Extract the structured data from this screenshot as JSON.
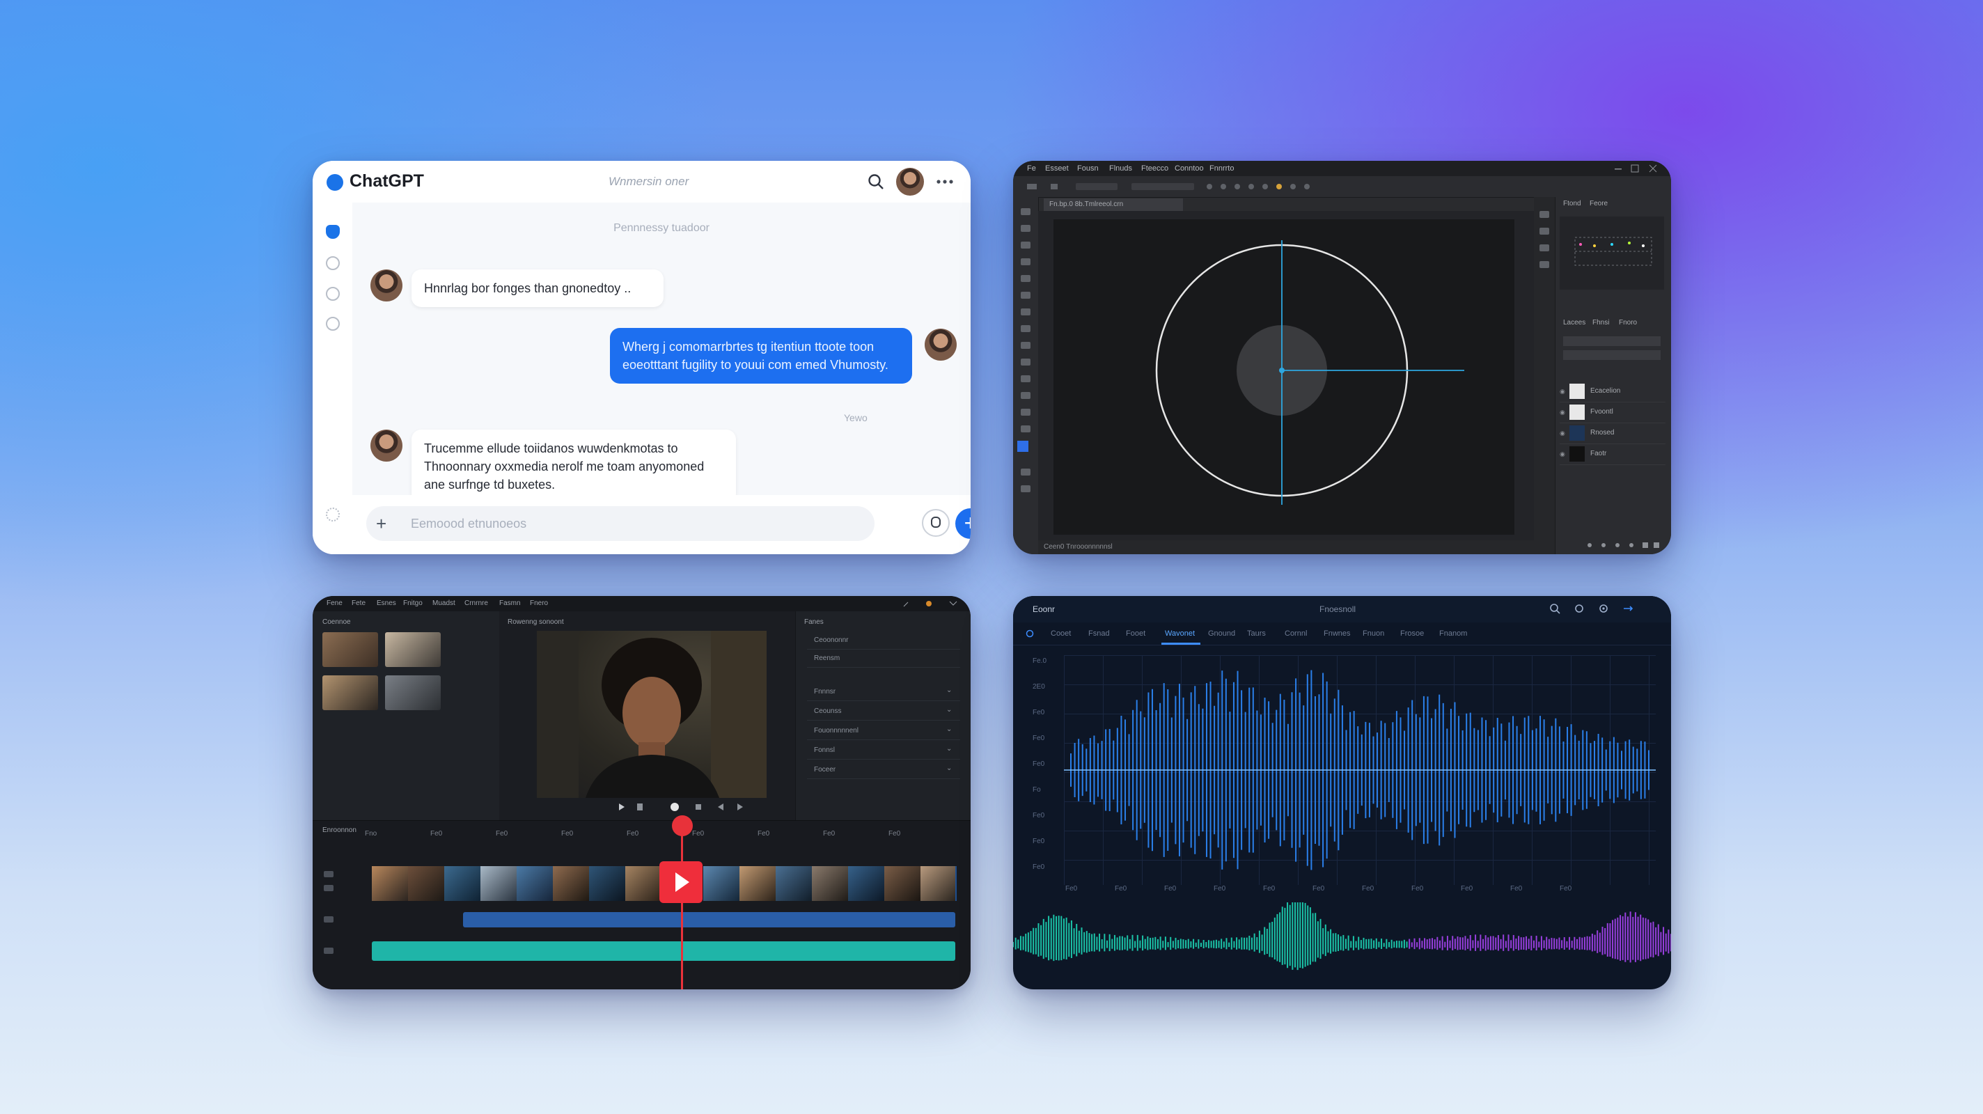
{
  "chat": {
    "app_title": "ChatGPT",
    "subtitle": "Wnmersin oner",
    "date_separator": "Pennnessy tuadoor",
    "messages": [
      {
        "text": "Hnnrlag bor fonges than gnonedtoy .."
      },
      {
        "text": "Wherg j comomarrbrtes tg itentiun ttoote toon eoeotttant fugility to youui com emed Vhumosty."
      },
      {
        "text": "Trucemme ellude toiidanos wuwdenkmotas to Thnoonnary oxxmedia nerolf me toam anyomoned ane surfnge td buxetes."
      }
    ],
    "sent_time": "Yewo",
    "composer_placeholder": "Eemoood etnunoeos",
    "icons": [
      "search-icon",
      "avatar",
      "more-icon",
      "plus-icon",
      "mic-icon",
      "send-icon",
      "settings-icon"
    ]
  },
  "photoshop": {
    "menu": [
      "Fe",
      "Esseet",
      "Fousn",
      "Flnuds",
      "Fteecco",
      "Conntoo",
      "Fnnrrto"
    ],
    "doc_tab": "Fn.bp.0 8b.Tmlreeol.crn",
    "status_text": "Ceen0   Tnrooonnnnnsl",
    "panel_tabs": [
      "Ftond",
      "Feore"
    ],
    "layers_tabs": [
      "Lacees",
      "Fhnsi",
      "Fnoro"
    ],
    "layers": [
      {
        "name": "Ecacelion"
      },
      {
        "name": "Fvoontl"
      },
      {
        "name": "Rnosed"
      },
      {
        "name": "Faotr"
      }
    ],
    "swatch_colors": [
      "#ff5bb8",
      "#2dd9ff",
      "#b7ff3a",
      "#ffd23d",
      "#ff3db0",
      "#6f7480"
    ]
  },
  "video_editor": {
    "menu": [
      "Fene",
      "Fete",
      "Esnes",
      "Fnitgo",
      "Muadst",
      "Crnrnre",
      "Fasmn",
      "Fnero"
    ],
    "media_label": "Coennoe",
    "preview_label": "Rowenng sonoont",
    "props_header": "Fanes",
    "props_items": [
      "Ceoononnr",
      "Reensm",
      "Fnnnsr",
      "Ceounss",
      "Fouonnnnnenl",
      "Fonnsl",
      "Foceer"
    ],
    "timeline_label": "Enroonnon",
    "ruler": [
      "Fno",
      "Fe0",
      "Fe0",
      "Fe0",
      "Fe0",
      "Fe0",
      "Fe0",
      "Fe0",
      "Fe0",
      "Fe0"
    ],
    "icons": [
      "play-icon",
      "playhead-handle"
    ]
  },
  "audio": {
    "logo": "Eoonr",
    "title": "Fnoesnoll",
    "tabs": [
      "Cooet",
      "Fsnad",
      "Fooet",
      "Wavonet",
      "Gnound",
      "Taurs",
      "Cornnl",
      "Fnwnes",
      "Fnuon",
      "Frosoe",
      "Fnanom"
    ],
    "active_tab": "Wavonet",
    "y_ticks": [
      "Fe.0",
      "2E0",
      "Fe0",
      "Fe0",
      "Fe0",
      "Fo",
      "Fe0",
      "Fe0",
      "Fe0",
      "Fe0"
    ],
    "x_ticks": [
      "Fe0",
      "Fe0",
      "Fe0",
      "Fe0",
      "Fe0",
      "Fe0",
      "Fe0",
      "Fe0",
      "Fe0",
      "Fe0",
      "Fe0",
      "Fe0"
    ],
    "waveform_color": "#2e8bff",
    "spectrum_colors": [
      "#1ee3c0",
      "#b146ff"
    ]
  }
}
